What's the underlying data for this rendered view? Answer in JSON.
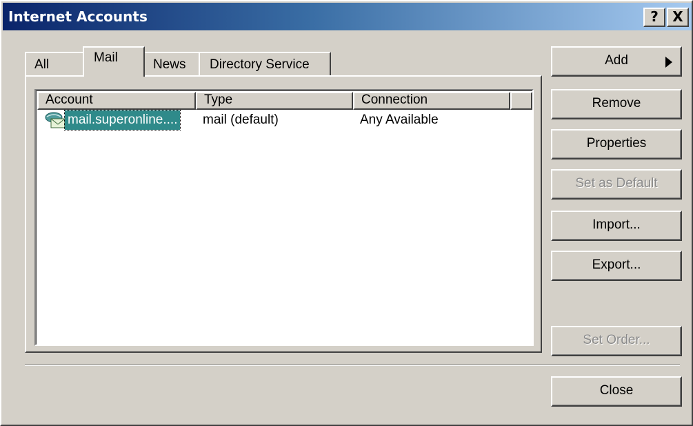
{
  "window": {
    "title": "Internet Accounts",
    "help_label": "?",
    "close_label": "X"
  },
  "tabs": [
    {
      "label": "All",
      "active": false
    },
    {
      "label": "Mail",
      "active": true
    },
    {
      "label": "News",
      "active": false
    },
    {
      "label": "Directory Service",
      "active": false
    }
  ],
  "list": {
    "columns": [
      "Account",
      "Type",
      "Connection",
      ""
    ],
    "rows": [
      {
        "icon": "mail-account-icon",
        "account": "mail.superonline....",
        "type": "mail (default)",
        "connection": "Any Available",
        "selected": true
      }
    ]
  },
  "buttons": {
    "add": "Add",
    "remove": "Remove",
    "properties": "Properties",
    "set_default": "Set as Default",
    "import": "Import...",
    "export": "Export...",
    "set_order": "Set Order...",
    "close": "Close"
  },
  "colors": {
    "selection": "#2f8a8a",
    "title_start": "#0a246a",
    "title_end": "#a6caf0",
    "face": "#d4d0c8"
  }
}
